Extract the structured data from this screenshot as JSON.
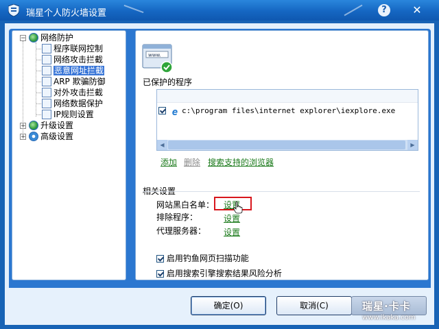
{
  "window": {
    "title": "瑞星个人防火墙设置",
    "help_icon": "question-icon",
    "close_icon": "close-icon"
  },
  "tree": {
    "nodes": [
      {
        "label": "网络防护",
        "icon": "globe-icon",
        "expanded": true
      },
      {
        "label": "程序联网控制",
        "icon": "page-icon"
      },
      {
        "label": "网络攻击拦截",
        "icon": "page-icon"
      },
      {
        "label": "恶意网址拦截",
        "icon": "page-icon",
        "selected": true
      },
      {
        "label": "ARP 欺骗防御",
        "icon": "page-icon"
      },
      {
        "label": "对外攻击拦截",
        "icon": "page-icon"
      },
      {
        "label": "网络数据保护",
        "icon": "page-icon"
      },
      {
        "label": "IP规则设置",
        "icon": "page-icon"
      },
      {
        "label": "升级设置",
        "icon": "globe-icon",
        "expanded": false
      },
      {
        "label": "高级设置",
        "icon": "gear-icon",
        "expanded": false
      }
    ]
  },
  "content": {
    "banner_text": "www.",
    "protected_title": "已保护的程序",
    "programs": [
      {
        "checked": true,
        "path": "c:\\program files\\internet explorer\\iexplore.exe"
      }
    ],
    "actions": {
      "add": "添加",
      "delete": "删除",
      "search_browsers": "搜索支持的浏览器"
    },
    "related_title": "相关设置",
    "settings_rows": [
      {
        "label": "网站黑白名单：",
        "link": "设置"
      },
      {
        "label": "排除程序：",
        "link": "设置"
      },
      {
        "label": "代理服务器：",
        "link": "设置"
      }
    ],
    "options": [
      {
        "label": "启用钓鱼网页扫描功能",
        "checked": true
      },
      {
        "label": "启用搜索引擎搜索结果风险分析",
        "checked": true
      }
    ]
  },
  "buttons": {
    "ok": "确定(O)",
    "cancel": "取消(C)"
  },
  "watermark": {
    "line1": "瑞星·卡卡",
    "line2": "www.ikaka.com"
  },
  "colors": {
    "title_bar": "#1566c2",
    "link_green": "#1b7a1b",
    "highlight_red": "#d8161c",
    "selection": "#3875d7"
  }
}
